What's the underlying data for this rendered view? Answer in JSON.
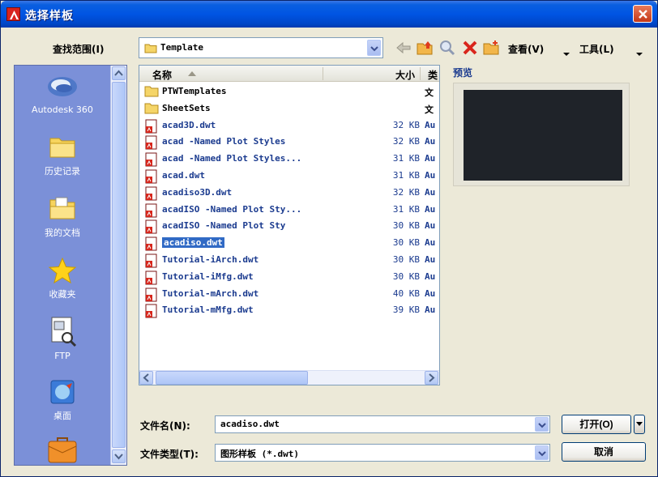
{
  "window": {
    "title": "选择样板"
  },
  "toolbar": {
    "lookin_label": "查找范围(I)",
    "lookin_value": "Template",
    "view_label": "查看(V)",
    "tools_label": "工具(L)"
  },
  "places": [
    {
      "label": "Autodesk 360",
      "icon": "cloud-icon"
    },
    {
      "label": "历史记录",
      "icon": "folder-icon"
    },
    {
      "label": "我的文档",
      "icon": "documents-folder-icon"
    },
    {
      "label": "收藏夹",
      "icon": "star-icon"
    },
    {
      "label": "FTP",
      "icon": "ftp-icon"
    },
    {
      "label": "桌面",
      "icon": "desktop-icon"
    },
    {
      "label": "",
      "icon": "briefcase-icon"
    }
  ],
  "filelist": {
    "col_name": "名称",
    "col_size": "大小",
    "col_type": "类",
    "rows": [
      {
        "name": "PTWTemplates",
        "size": "",
        "type": "文",
        "kind": "folder"
      },
      {
        "name": "SheetSets",
        "size": "",
        "type": "文",
        "kind": "folder"
      },
      {
        "name": "acad3D.dwt",
        "size": "32 KB",
        "type": "Au",
        "kind": "file"
      },
      {
        "name": "acad -Named Plot Styles",
        "size": "32 KB",
        "type": "Au",
        "kind": "file"
      },
      {
        "name": "acad -Named Plot Styles...",
        "size": "31 KB",
        "type": "Au",
        "kind": "file"
      },
      {
        "name": "acad.dwt",
        "size": "31 KB",
        "type": "Au",
        "kind": "file"
      },
      {
        "name": "acadiso3D.dwt",
        "size": "32 KB",
        "type": "Au",
        "kind": "file"
      },
      {
        "name": "acadISO -Named Plot Sty...",
        "size": "31 KB",
        "type": "Au",
        "kind": "file"
      },
      {
        "name": "acadISO -Named Plot Sty",
        "size": "30 KB",
        "type": "Au",
        "kind": "file"
      },
      {
        "name": "acadiso.dwt",
        "size": "30 KB",
        "type": "Au",
        "kind": "file",
        "selected": true
      },
      {
        "name": "Tutorial-iArch.dwt",
        "size": "30 KB",
        "type": "Au",
        "kind": "file"
      },
      {
        "name": "Tutorial-iMfg.dwt",
        "size": "30 KB",
        "type": "Au",
        "kind": "file"
      },
      {
        "name": "Tutorial-mArch.dwt",
        "size": "40 KB",
        "type": "Au",
        "kind": "file"
      },
      {
        "name": "Tutorial-mMfg.dwt",
        "size": "39 KB",
        "type": "Au",
        "kind": "file"
      }
    ]
  },
  "preview": {
    "label": "预览"
  },
  "form": {
    "filename_label": "文件名(N):",
    "filename_value": "acadiso.dwt",
    "filetype_label": "文件类型(T):",
    "filetype_value": "图形样板 (*.dwt)",
    "open_label": "打开(O)",
    "cancel_label": "取消"
  },
  "colors": {
    "titlebar": "#0054e3",
    "places_bg": "#7b90d8",
    "selection": "#316ac5",
    "preview_image": "#1f2329"
  }
}
